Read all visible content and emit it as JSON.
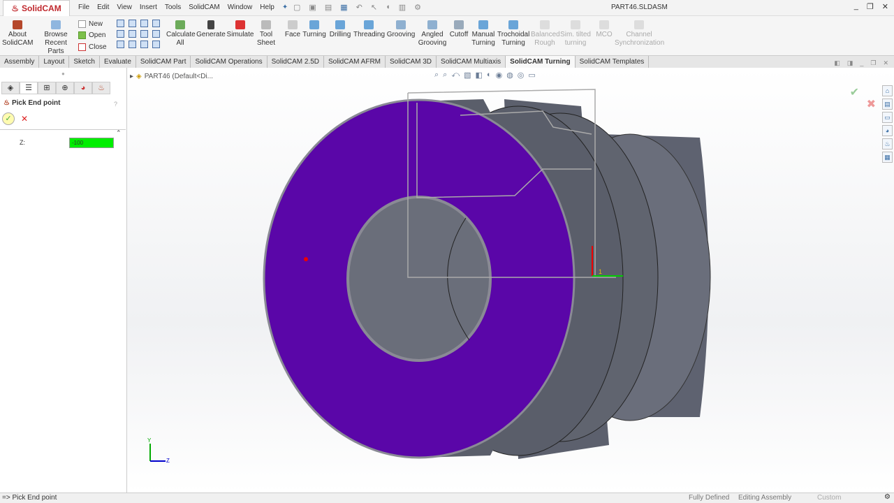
{
  "app": {
    "logo": "SolidCAM",
    "document_title": "PART46.SLDASM"
  },
  "menu": [
    "File",
    "Edit",
    "View",
    "Insert",
    "Tools",
    "SolidCAM",
    "Window",
    "Help"
  ],
  "ribbon": {
    "about": "About SolidCAM",
    "browse": "Browse Recent Parts",
    "new": "New",
    "open": "Open",
    "close": "Close",
    "calculate": "Calculate All",
    "generate": "Generate",
    "simulate": "Simulate",
    "tool_sheet": "Tool Sheet",
    "face": "Face",
    "turning": "Turning",
    "drilling": "Drilling",
    "threading": "Threading",
    "grooving": "Grooving",
    "angled_grooving": "Angled Grooving",
    "cutoff": "Cutoff",
    "manual_turning": "Manual Turning",
    "trochoidal_turning": "Trochoidal Turning",
    "balanced_rough": "Balanced Rough",
    "sim_tilted": "Sim. tilted turning",
    "mco": "MCO",
    "channel_sync": "Channel Synchronization"
  },
  "tabs": [
    "Assembly",
    "Layout",
    "Sketch",
    "Evaluate",
    "SolidCAM Part",
    "SolidCAM Operations",
    "SolidCAM 2.5D",
    "SolidCAM AFRM",
    "SolidCAM 3D",
    "SolidCAM Multiaxis",
    "SolidCAM Turning",
    "SolidCAM Templates"
  ],
  "active_tab": "SolidCAM Turning",
  "panel": {
    "title": "Pick End point",
    "help": "?",
    "z_label": "Z:",
    "z_value": "-100"
  },
  "tree": {
    "item": "PART46  (Default<Di..."
  },
  "status": {
    "left": "Pick End point",
    "defined": "Fully Defined",
    "editing": "Editing Assembly",
    "units": "Custom"
  },
  "colors": {
    "face": "#5a06a8",
    "body": "#5e6270",
    "z_field": "#00ee00"
  }
}
